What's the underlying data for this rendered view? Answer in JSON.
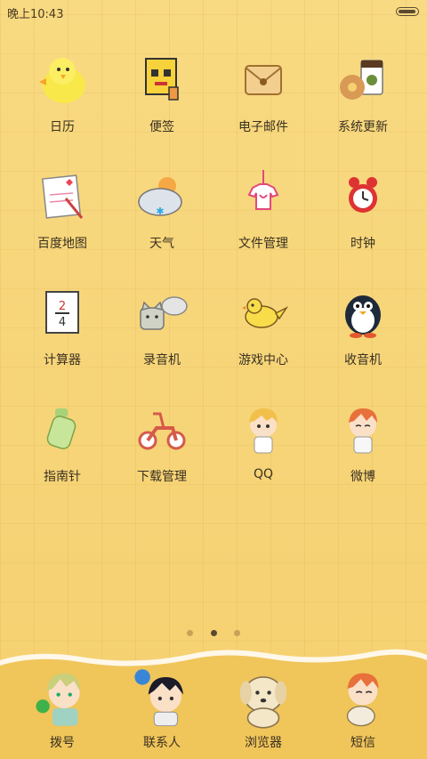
{
  "status_bar": {
    "time": "晚上10:43"
  },
  "apps": [
    {
      "label": "日历",
      "icon": "chick-icon"
    },
    {
      "label": "便签",
      "icon": "notepad-icon"
    },
    {
      "label": "电子邮件",
      "icon": "envelope-icon"
    },
    {
      "label": "系统更新",
      "icon": "coffee-donut-icon"
    },
    {
      "label": "百度地图",
      "icon": "love-note-icon"
    },
    {
      "label": "天气",
      "icon": "cloud-sun-icon"
    },
    {
      "label": "文件管理",
      "icon": "shirt-tag-icon"
    },
    {
      "label": "时钟",
      "icon": "alarm-clock-icon"
    },
    {
      "label": "计算器",
      "icon": "calculator-icon"
    },
    {
      "label": "录音机",
      "icon": "cat-speech-icon"
    },
    {
      "label": "游戏中心",
      "icon": "bird-icon"
    },
    {
      "label": "收音机",
      "icon": "penguin-icon"
    },
    {
      "label": "指南针",
      "icon": "bottle-icon"
    },
    {
      "label": "下载管理",
      "icon": "scooter-icon"
    },
    {
      "label": "QQ",
      "icon": "anime-boy-blonde-icon"
    },
    {
      "label": "微博",
      "icon": "anime-boy-orange-icon"
    }
  ],
  "page_indicator": {
    "count": 3,
    "active": 1
  },
  "dock": [
    {
      "label": "拨号",
      "icon": "anime-boy-green-icon"
    },
    {
      "label": "联系人",
      "icon": "anime-boy-dark-icon"
    },
    {
      "label": "浏览器",
      "icon": "dog-icon"
    },
    {
      "label": "短信",
      "icon": "anime-boy-puppy-icon"
    }
  ]
}
